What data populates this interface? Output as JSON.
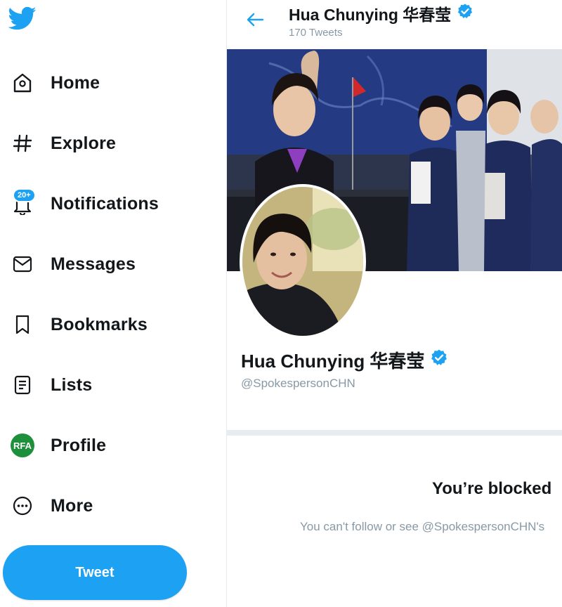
{
  "header": {
    "display_name": "Hua Chunying 华春莹",
    "tweet_count": "170 Tweets"
  },
  "sidebar": {
    "items": [
      {
        "label": "Home",
        "icon": "home-icon"
      },
      {
        "label": "Explore",
        "icon": "hashtag-icon"
      },
      {
        "label": "Notifications",
        "icon": "bell-icon",
        "badge": "20+"
      },
      {
        "label": "Messages",
        "icon": "envelope-icon"
      },
      {
        "label": "Bookmarks",
        "icon": "bookmark-icon"
      },
      {
        "label": "Lists",
        "icon": "list-icon"
      },
      {
        "label": "Profile",
        "icon": "avatar",
        "avatar_text": "RFA"
      },
      {
        "label": "More",
        "icon": "more-icon"
      }
    ],
    "tweet_button": "Tweet"
  },
  "profile": {
    "display_name": "Hua Chunying 华春莹",
    "handle": "@SpokespersonCHN",
    "verified": true
  },
  "blocked": {
    "title": "You’re blocked",
    "message": "You can't follow or see @SpokespersonCHN's"
  },
  "colors": {
    "accent": "#1da1f2",
    "text_primary": "#14171a",
    "text_secondary": "#8899a6",
    "divider": "#e6ecf0"
  }
}
